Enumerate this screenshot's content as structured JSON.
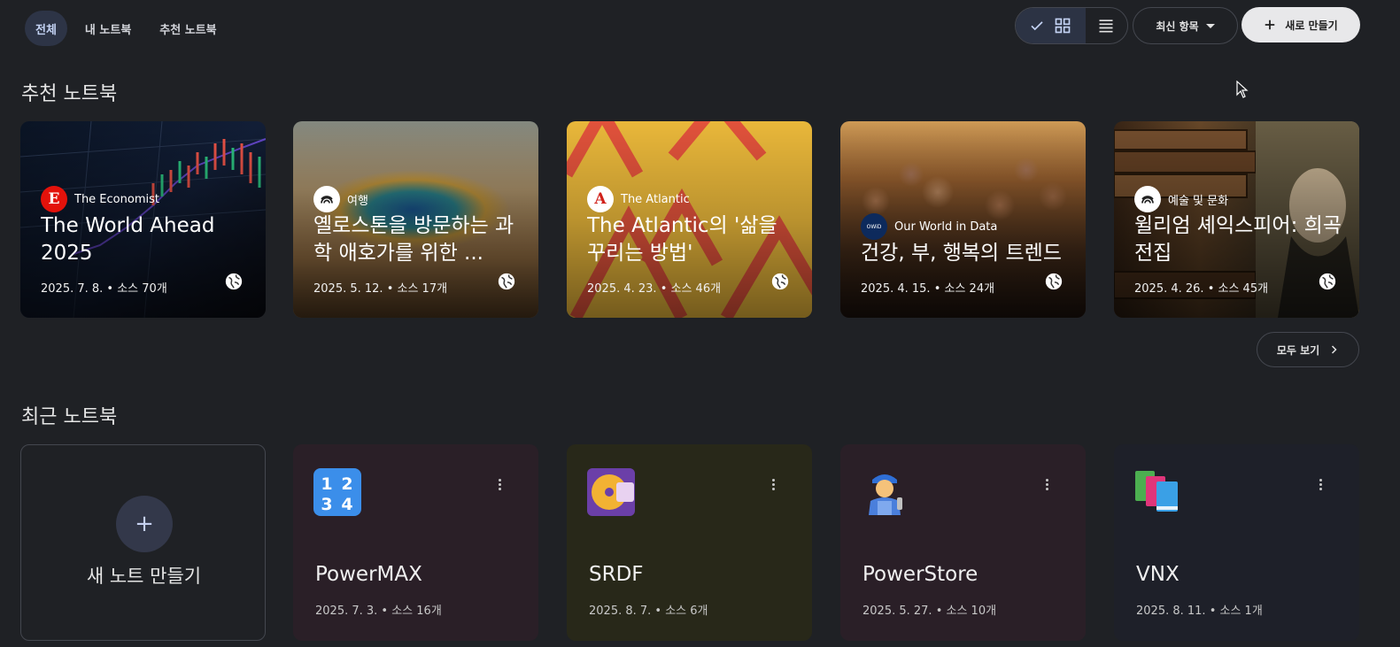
{
  "tabs": [
    {
      "label": "전체",
      "active": true
    },
    {
      "label": "내 노트북",
      "active": false
    },
    {
      "label": "추천 노트북",
      "active": false
    }
  ],
  "toolbar": {
    "view_grid_icon": "grid-icon",
    "view_list_icon": "list-icon",
    "sort_label": "최신 항목",
    "new_label": "새로 만들기"
  },
  "featured": {
    "title": "추천 노트북",
    "see_all": "모두 보기",
    "cards": [
      {
        "source": "The Economist",
        "title": "The World Ahead 2025",
        "meta": "2025. 7. 8. • 소스 70개"
      },
      {
        "source": "여행",
        "title": "옐로스톤을 방문하는 과학 애호가를 위한 ...",
        "meta": "2025. 5. 12. • 소스 17개"
      },
      {
        "source": "The Atlantic",
        "title": "The Atlantic의 '삶을 꾸리는 방법'",
        "meta": "2025. 4. 23. • 소스 46개"
      },
      {
        "source": "Our World in Data",
        "title": "건강, 부, 행복의 트렌드",
        "meta": "2025. 4. 15. • 소스 24개"
      },
      {
        "source": "예술 및 문화",
        "title": "윌리엄 셰익스피어: 희곡 전집",
        "meta": "2025. 4. 26. • 소스 45개"
      }
    ]
  },
  "recent": {
    "title": "최근 노트북",
    "new_note_label": "새 노트 만들기",
    "cards": [
      {
        "title": "PowerMAX",
        "meta": "2025. 7. 3. • 소스 16개",
        "icon": "numbers-1234-icon",
        "bg": "#2a1f27"
      },
      {
        "title": "SRDF",
        "meta": "2025. 8. 7. • 소스 6개",
        "icon": "minidisc-icon",
        "bg": "#282819"
      },
      {
        "title": "PowerStore",
        "meta": "2025. 5. 27. • 소스 10개",
        "icon": "mechanic-icon",
        "bg": "#2a1f27"
      },
      {
        "title": "VNX",
        "meta": "2025. 8. 11. • 소스 1개",
        "icon": "books-icon",
        "bg": "#1e2029"
      }
    ]
  }
}
